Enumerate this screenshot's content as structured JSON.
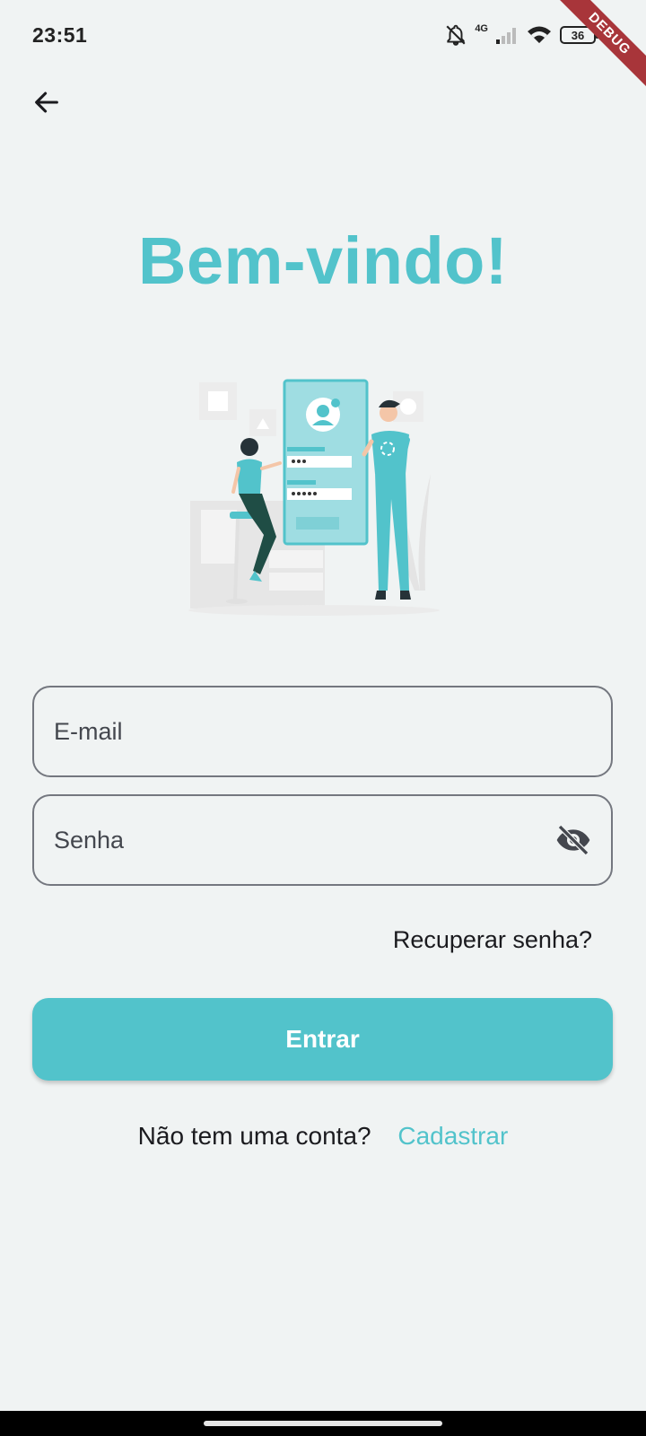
{
  "status_bar": {
    "time": "23:51",
    "network": "4G",
    "battery": "36",
    "icons": [
      "bell-off-icon",
      "signal-icon",
      "wifi-icon",
      "battery-icon"
    ]
  },
  "debug_banner": "DEBUG",
  "header": {
    "back_icon": "arrow-back-icon"
  },
  "title": "Bem-vindo!",
  "form": {
    "email_placeholder": "E-mail",
    "password_placeholder": "Senha",
    "password_visibility_icon": "eye-off-icon",
    "recover_label": "Recuperar senha?",
    "submit_label": "Entrar"
  },
  "signup": {
    "prompt": "Não tem uma conta?",
    "link_label": "Cadastrar"
  },
  "colors": {
    "accent": "#52c3cb",
    "background": "#f0f3f3",
    "text": "#1b1b1f",
    "field_border": "#74777f"
  }
}
